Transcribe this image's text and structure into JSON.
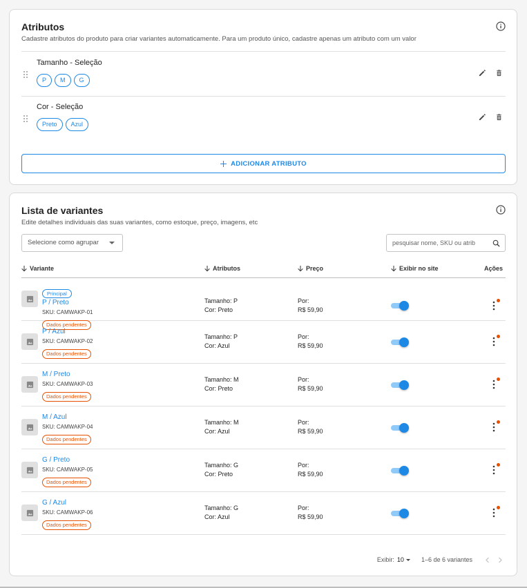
{
  "attributes_card": {
    "title": "Atributos",
    "subtitle": "Cadastre atributos do produto para criar variantes automaticamente. Para um produto único, cadastre apenas um atributo com um valor",
    "items": [
      {
        "name": "Tamanho - Seleção",
        "values": [
          "P",
          "M",
          "G"
        ]
      },
      {
        "name": "Cor - Seleção",
        "values": [
          "Preto",
          "Azul"
        ]
      }
    ],
    "add_button": "ADICIONAR ATRIBUTO"
  },
  "variants_card": {
    "title": "Lista de variantes",
    "subtitle": "Edite detalhes individuais das suas variantes, como estoque, preço, imagens, etc",
    "group_select": "Selecione como agrupar",
    "search_placeholder": "pesquisar nome, SKU ou atrib",
    "columns": {
      "variant": "Variante",
      "attributes": "Atributos",
      "price": "Preço",
      "show_on_site": "Exibir no site",
      "actions": "Ações"
    },
    "main_badge": "Principal",
    "rows": [
      {
        "name": "P / Preto",
        "sku": "SKU: CAMWAKP-01",
        "status": "Dados pendentes",
        "attr1": "Tamanho: P",
        "attr2": "Cor: Preto",
        "price_label": "Por:",
        "price": "R$ 59,90",
        "visible": true,
        "main": true
      },
      {
        "name": "P / Azul",
        "sku": "SKU: CAMWAKP-02",
        "status": "Dados pendentes",
        "attr1": "Tamanho: P",
        "attr2": "Cor: Azul",
        "price_label": "Por:",
        "price": "R$ 59,90",
        "visible": true,
        "main": false
      },
      {
        "name": "M / Preto",
        "sku": "SKU: CAMWAKP-03",
        "status": "Dados pendentes",
        "attr1": "Tamanho: M",
        "attr2": "Cor: Preto",
        "price_label": "Por:",
        "price": "R$ 59,90",
        "visible": true,
        "main": false
      },
      {
        "name": "M / Azul",
        "sku": "SKU: CAMWAKP-04",
        "status": "Dados pendentes",
        "attr1": "Tamanho: M",
        "attr2": "Cor: Azul",
        "price_label": "Por:",
        "price": "R$ 59,90",
        "visible": true,
        "main": false
      },
      {
        "name": "G / Preto",
        "sku": "SKU: CAMWAKP-05",
        "status": "Dados pendentes",
        "attr1": "Tamanho: G",
        "attr2": "Cor: Preto",
        "price_label": "Por:",
        "price": "R$ 59,90",
        "visible": true,
        "main": false
      },
      {
        "name": "G / Azul",
        "sku": "SKU: CAMWAKP-06",
        "status": "Dados pendentes",
        "attr1": "Tamanho: G",
        "attr2": "Cor: Azul",
        "price_label": "Por:",
        "price": "R$ 59,90",
        "visible": true,
        "main": false
      }
    ],
    "footer": {
      "per_page_label": "Exibir:",
      "per_page_value": "10",
      "range": "1–6 de 6 variantes"
    }
  },
  "colors": {
    "accent": "#1e88e5",
    "warning": "#e65100",
    "border": "#d9d9d9"
  },
  "icons": [
    "info-icon",
    "drag-handle-icon",
    "edit-icon",
    "delete-icon",
    "plus-icon",
    "search-icon",
    "arrow-down-icon",
    "image-icon",
    "more-vert-icon",
    "chevron-left-icon",
    "chevron-right-icon"
  ]
}
